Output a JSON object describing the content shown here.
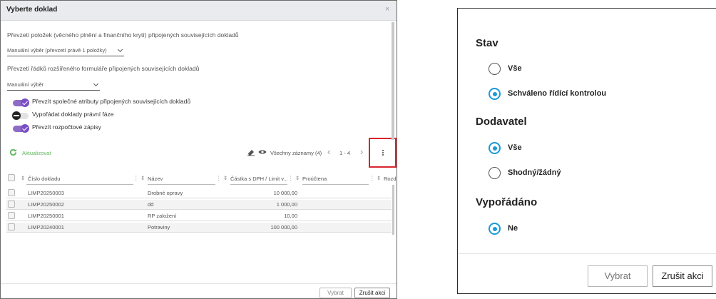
{
  "dialog": {
    "title": "Vyberte doklad",
    "close": "×",
    "desc1": "Převzetí položek (věcného plnění a finančního krytí) připojených souvisejících dokladů",
    "select1": "Manuální výběr (převzetí právě 1 položky)",
    "desc2": "Převzetí řádků rozšířeného formuláře připojených souvisejících dokladů",
    "select2": "Manuální výběr",
    "toggles": [
      {
        "label": "Převzít společné atributy připojených souvisejících dokladů",
        "on": true
      },
      {
        "label": "Vypořádat doklady právní fáze",
        "on": false
      },
      {
        "label": "Převzít rozpočtové zápisy",
        "on": true
      }
    ],
    "toolbar": {
      "refresh": "Aktualizovat",
      "records": "Všechny záznamy (4)",
      "page": "1 - 4"
    },
    "columns": [
      "Číslo dokladu",
      "Název",
      "Částka s DPH / Limit v...",
      "Proúčtena",
      "Rozdíl"
    ],
    "rows": [
      {
        "number": "LIMP20250003",
        "name": "Drobné opravy",
        "amount": "10 000,00"
      },
      {
        "number": "LIMP20250002",
        "name": "dd",
        "amount": "1 000,00"
      },
      {
        "number": "LIMP20250001",
        "name": "RP založení",
        "amount": "10,00"
      },
      {
        "number": "LIMP20240001",
        "name": "Potraviny",
        "amount": "100 000,00"
      }
    ],
    "buttons": {
      "select": "Vybrat",
      "cancel": "Zrušit akci"
    }
  },
  "filter_panel": {
    "groups": [
      {
        "heading": "Stav",
        "options": [
          {
            "label": "Vše",
            "selected": false
          },
          {
            "label": "Schváleno řídící kontrolou",
            "selected": true
          }
        ]
      },
      {
        "heading": "Dodavatel",
        "options": [
          {
            "label": "Vše",
            "selected": true
          },
          {
            "label": "Shodný/žádný",
            "selected": false
          }
        ]
      },
      {
        "heading": "Vypořádáno",
        "options": [
          {
            "label": "Ne",
            "selected": true
          }
        ]
      }
    ],
    "buttons": {
      "select": "Vybrat",
      "cancel": "Zrušit akci"
    }
  },
  "colors": {
    "accent_purple": "#7a4fc4",
    "radio_blue": "#1a9bd7",
    "refresh_green": "#5cb85c",
    "highlight_red": "#d9242c"
  }
}
